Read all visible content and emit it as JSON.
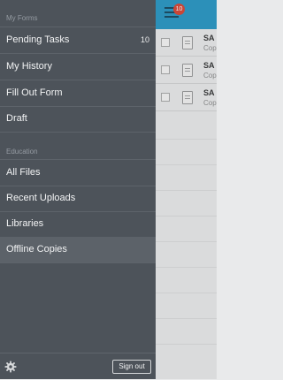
{
  "colors": {
    "drawer_bg": "#4d535a",
    "header_blue": "#2f99c5",
    "badge_red": "#d64b3b",
    "selected_item": "#5c6269"
  },
  "app_header": {
    "menu_icon": "hamburger-menu-icon",
    "badge": "10"
  },
  "list_rows": [
    {
      "title": "SA",
      "subtitle": "Cop"
    },
    {
      "title": "SA",
      "subtitle": "Cop"
    },
    {
      "title": "SA",
      "subtitle": "Cop"
    }
  ],
  "drawer": {
    "sections": [
      {
        "label": "My Forms",
        "items": [
          {
            "label": "Pending Tasks",
            "count": "10"
          },
          {
            "label": "My History"
          },
          {
            "label": "Fill Out Form"
          },
          {
            "label": "Draft"
          }
        ]
      },
      {
        "label": "Education",
        "items": [
          {
            "label": "All Files"
          },
          {
            "label": "Recent Uploads"
          },
          {
            "label": "Libraries"
          },
          {
            "label": "Offline Copies",
            "selected": true
          }
        ]
      }
    ],
    "footer": {
      "settings_icon": "gear-icon",
      "sign_out_label": "Sign out"
    }
  }
}
